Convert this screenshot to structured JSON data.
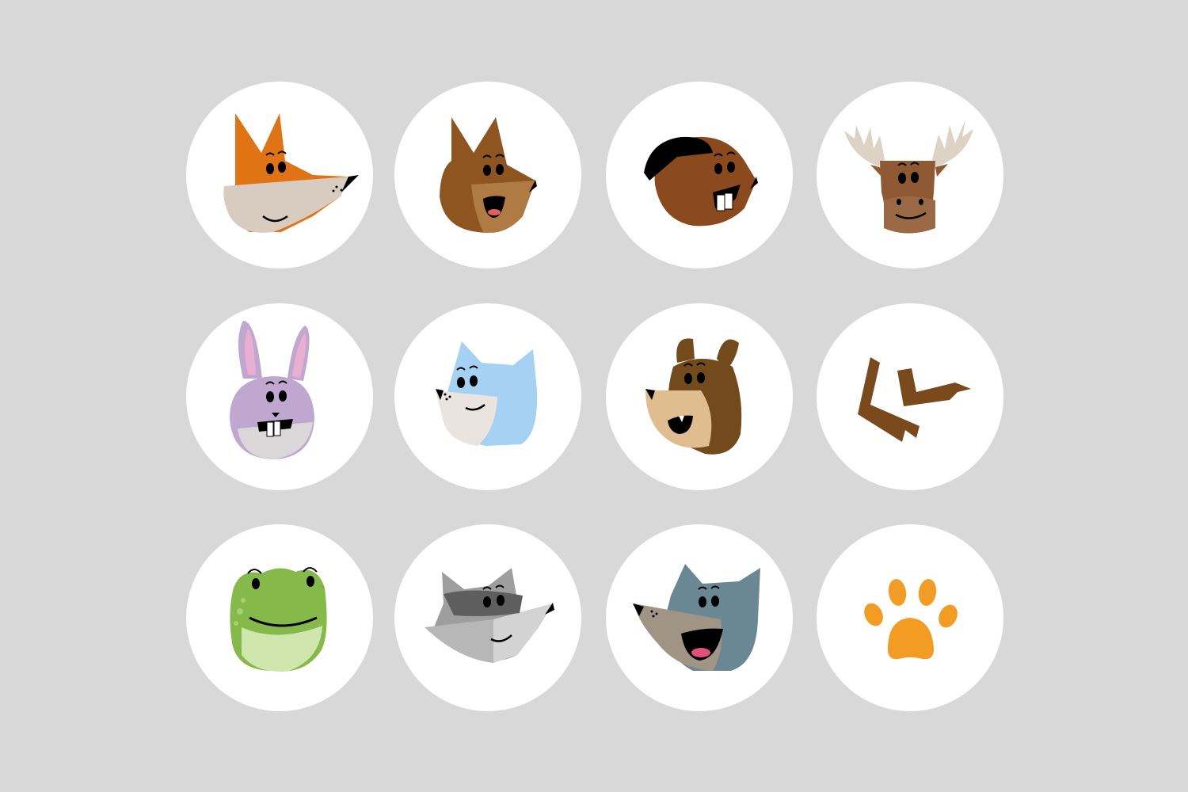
{
  "avatars": [
    {
      "icon": "fox-icon",
      "colors": {
        "fur": "#e07314",
        "muzzle": "#d8ccc0"
      }
    },
    {
      "icon": "squirrel-icon",
      "colors": {
        "fur": "#8e5520",
        "muzzle": "#b07a45"
      }
    },
    {
      "icon": "beaver-icon",
      "colors": {
        "fur": "#8b4a1e",
        "cap": "#000000"
      }
    },
    {
      "icon": "moose-icon",
      "colors": {
        "fur": "#8f5a33",
        "antler": "#ddd3c4"
      }
    },
    {
      "icon": "rabbit-icon",
      "colors": {
        "fur": "#bfa7d0",
        "ear_inner": "#eaaed0"
      }
    },
    {
      "icon": "cat-icon",
      "colors": {
        "fur": "#a5d2f2",
        "muzzle": "#e9e4df"
      }
    },
    {
      "icon": "bear-icon",
      "colors": {
        "fur": "#734a1c",
        "muzzle": "#e0bd8e"
      }
    },
    {
      "icon": "antler-icon",
      "colors": {
        "antler": "#7a4a1c"
      }
    },
    {
      "icon": "frog-icon",
      "colors": {
        "skin": "#85b94a",
        "belly": "#cfe6ad"
      }
    },
    {
      "icon": "raccoon-icon",
      "colors": {
        "fur": "#9e9e9e",
        "mask": "#5e5e5e"
      }
    },
    {
      "icon": "wolf-icon",
      "colors": {
        "fur": "#6a8893",
        "muzzle": "#a09485"
      }
    },
    {
      "icon": "paw-icon",
      "colors": {
        "paw": "#f39c24"
      }
    }
  ],
  "colors": {
    "background": "#d8d8d8",
    "tile": "#ffffff",
    "ink": "#000000"
  }
}
